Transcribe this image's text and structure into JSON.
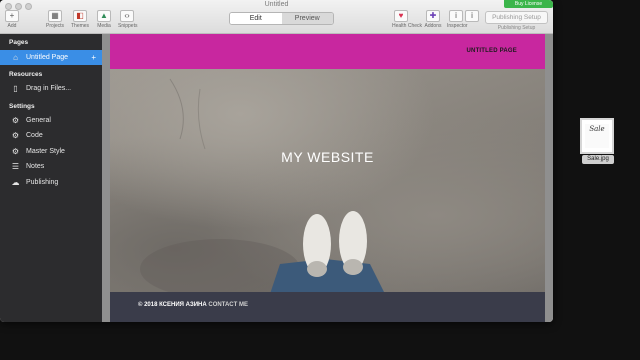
{
  "window": {
    "title": "Untitled",
    "license_button": "Buy License"
  },
  "toolbar": {
    "items": [
      {
        "label": "Add",
        "icon": "plus-icon"
      },
      {
        "label": "Projects",
        "icon": "grid-icon"
      },
      {
        "label": "Themes",
        "icon": "palette-icon"
      },
      {
        "label": "Media",
        "icon": "image-icon"
      },
      {
        "label": "Snippets",
        "icon": "code-icon"
      }
    ],
    "mode_edit": "Edit",
    "mode_preview": "Preview",
    "right_items": [
      {
        "label": "Health Check",
        "icon": "heart-icon"
      },
      {
        "label": "Addons",
        "icon": "puzzle-icon"
      },
      {
        "label": "Inspector",
        "icon": "info-icon"
      }
    ],
    "publishing_button": "Publishing Setup",
    "publishing_sub": "Publishing Setup"
  },
  "sidebar": {
    "pages_header": "Pages",
    "pages": [
      {
        "label": "Untitled Page",
        "icon": "home-icon",
        "selected": true
      }
    ],
    "resources_header": "Resources",
    "resources": [
      {
        "label": "Drag in Files...",
        "icon": "file-icon"
      }
    ],
    "settings_header": "Settings",
    "settings": [
      {
        "label": "General",
        "icon": "gear-icon"
      },
      {
        "label": "Code",
        "icon": "gear-icon"
      },
      {
        "label": "Master Style",
        "icon": "gear-icon"
      },
      {
        "label": "Notes",
        "icon": "notes-icon"
      },
      {
        "label": "Publishing",
        "icon": "cloud-icon"
      }
    ],
    "add_symbol": "+"
  },
  "page": {
    "header_title": "UNTITLED PAGE",
    "site_title": "MY WEBSITE",
    "footer_copy": "© 2018 КСЕНИЯ АЗИНА",
    "footer_link": "CONTACT ME",
    "header_color": "#c8279f",
    "footer_color": "#3a3c4a"
  },
  "desktop": {
    "file_label": "Sale.jpg",
    "file_thumb_text": "Sale"
  }
}
